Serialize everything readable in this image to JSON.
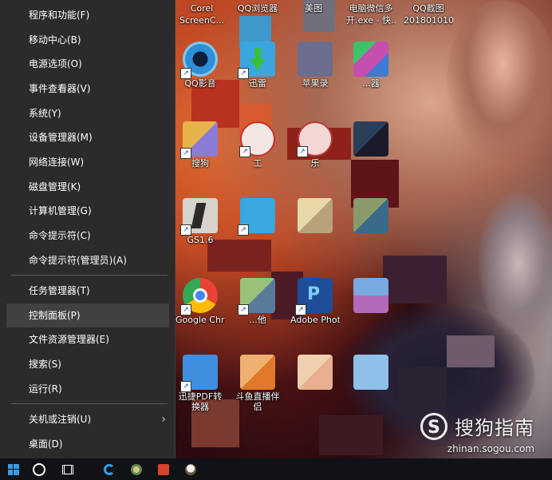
{
  "menu": {
    "items": [
      {
        "label": "程序和功能(F)"
      },
      {
        "label": "移动中心(B)"
      },
      {
        "label": "电源选项(O)"
      },
      {
        "label": "事件查看器(V)"
      },
      {
        "label": "系统(Y)"
      },
      {
        "label": "设备管理器(M)"
      },
      {
        "label": "网络连接(W)"
      },
      {
        "label": "磁盘管理(K)"
      },
      {
        "label": "计算机管理(G)"
      },
      {
        "label": "命令提示符(C)"
      },
      {
        "label": "命令提示符(管理员)(A)"
      },
      {
        "label": "任务管理器(T)"
      },
      {
        "label": "控制面板(P)",
        "highlighted": true
      },
      {
        "label": "文件资源管理器(E)"
      },
      {
        "label": "搜索(S)"
      },
      {
        "label": "运行(R)"
      },
      {
        "label": "关机或注销(U)"
      },
      {
        "label": "桌面(D)"
      }
    ]
  },
  "desktop": {
    "top_labels": [
      {
        "line1": "Corel",
        "line2": "ScreenC..."
      },
      {
        "line1": "QQ浏览器",
        "line2": ""
      },
      {
        "line1": "美图",
        "line2": ""
      },
      {
        "line1": "电脑微信多",
        "line2": "开.exe - 快..."
      },
      {
        "line1": "QQ截图",
        "line2": "201801010..."
      }
    ],
    "icons": [
      {
        "label": "QQ影音",
        "color": "#2d8fd6"
      },
      {
        "label": "迅雷",
        "color": "#3aa6e0"
      },
      {
        "label": "苹果录",
        "color": "#6d6d8f"
      },
      {
        "label": "...器",
        "color": "#c44fae"
      },
      {
        "label": "搜狗",
        "color": "#e6b34a"
      },
      {
        "label": "工",
        "color": "#c9302c"
      },
      {
        "label": "乐",
        "color": "#b83a3a"
      },
      {
        "label": "GS1.6",
        "color": "#2a2a2a"
      },
      {
        "label": "",
        "color": "#39a7e0"
      },
      {
        "label": "Google Chrome",
        "color": "#34a853"
      },
      {
        "label": "...他",
        "color": "#7c9c5a"
      },
      {
        "label": "Adobe Photo",
        "color": "#1f4d9a"
      },
      {
        "label": "迅捷PDF转换器",
        "color": "#3f8ee0"
      },
      {
        "label": "斗鱼直播伴侣",
        "color": "#e07a2a"
      }
    ]
  },
  "watermark": {
    "logo": "S",
    "name": "搜狗指南",
    "url": "zhinan.sogou.com"
  },
  "taskbar": {
    "items": [
      "start-icon",
      "cortana-icon",
      "task-view-icon",
      "qq-browser-icon",
      "game-icon",
      "app-icon",
      "pet-icon"
    ]
  }
}
